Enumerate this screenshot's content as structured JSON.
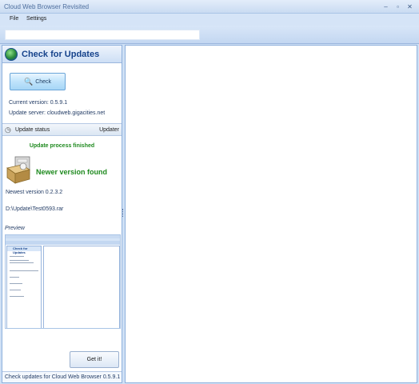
{
  "window": {
    "title": "Cloud Web Browser Revisited"
  },
  "window_buttons": {
    "minimize": "–",
    "maximize": "▫",
    "close": "✕"
  },
  "menu": {
    "items": [
      "File",
      "Settings"
    ]
  },
  "address_bar": {
    "value": ""
  },
  "panel": {
    "title": "Check for Updates",
    "check_button": "Check",
    "current_version": "Current version: 0.5.9.1",
    "update_server": "Update server: cloudweb.gigacities.net",
    "section_title": "Update status",
    "section_right": "Updater",
    "status_finished": "Update process finished",
    "newer_found": "Newer version found",
    "newest_version": "Newest version 0.2.3.2",
    "file_path": "D:\\Update\\Test0593.rar",
    "preview_label": "Preview",
    "getit_button": "Get it!",
    "status_text": "Check updates for Cloud Web Browser 0.5.9.1"
  },
  "colors": {
    "accent": "#15428b",
    "success": "#1f8a1f",
    "frame": "#cfe0f5"
  }
}
